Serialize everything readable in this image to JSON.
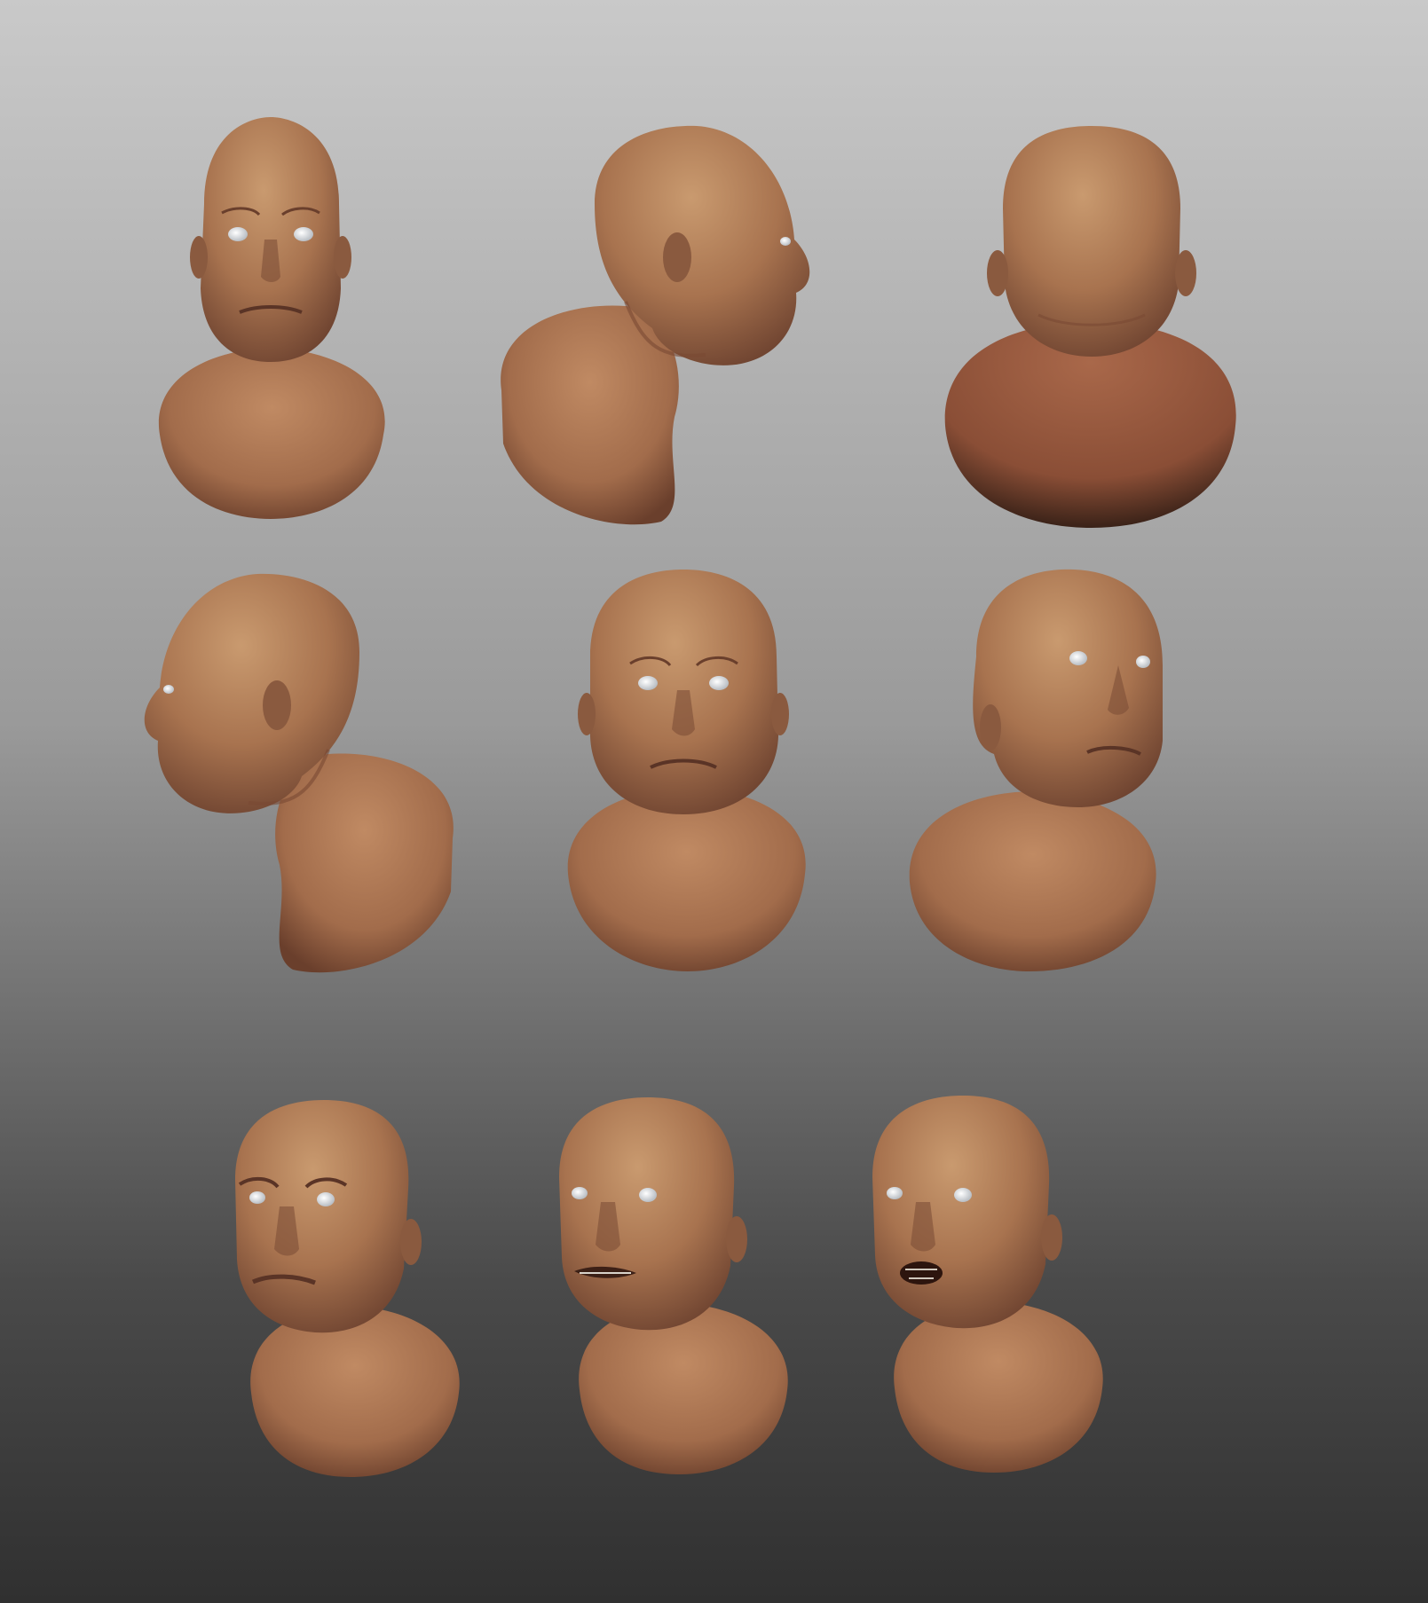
{
  "scene": {
    "background_top": "#c9c9c9",
    "background_bottom": "#303030",
    "skin_light": "#c08a63",
    "skin_mid": "#a26c4b",
    "skin_dark": "#6e4330",
    "eye_color": "#eef0f2"
  },
  "busts": [
    {
      "view": "front",
      "expression": "neutral"
    },
    {
      "view": "right-profile",
      "expression": "neutral"
    },
    {
      "view": "back",
      "expression": "neutral"
    },
    {
      "view": "left-profile",
      "expression": "neutral"
    },
    {
      "view": "front",
      "expression": "neutral"
    },
    {
      "view": "three-quarter-left",
      "expression": "neutral"
    },
    {
      "view": "three-quarter-right",
      "expression": "scowl"
    },
    {
      "view": "three-quarter-right",
      "expression": "grimace"
    },
    {
      "view": "three-quarter-right",
      "expression": "open-mouth"
    }
  ]
}
